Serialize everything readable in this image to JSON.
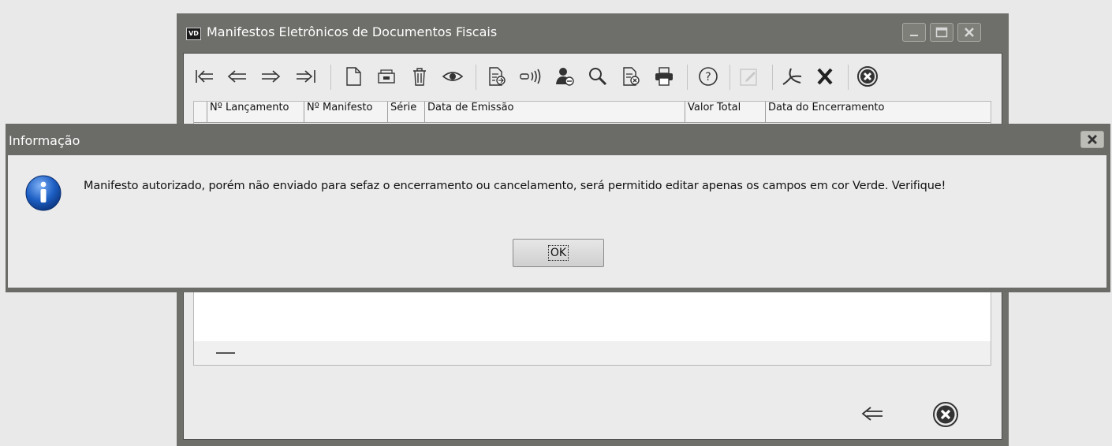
{
  "window": {
    "title": "Manifestos Eletrônicos de Documentos Fiscais",
    "logo_text": "VD"
  },
  "toolbar": {
    "icons": [
      "first-record-icon",
      "previous-record-icon",
      "next-record-icon",
      "last-record-icon",
      "new-document-icon",
      "archive-icon",
      "delete-icon",
      "view-icon",
      "document-import-icon",
      "transmit-icon",
      "user-icon",
      "search-icon",
      "cancel-document-icon",
      "print-icon",
      "help-icon",
      "edit-icon",
      "pdf-icon",
      "close-x-icon",
      "exit-icon"
    ]
  },
  "grid": {
    "columns": [
      "Nº Lançamento",
      "Nº Manifesto",
      "Série",
      "Data de Emissão",
      "Valor Total",
      "Data do Encerramento"
    ]
  },
  "dialog": {
    "title": "Informação",
    "message": "Manifesto autorizado, porém não enviado para sefaz o encerramento ou cancelamento, será permitido editar apenas os campos em cor Verde. Verifique!",
    "ok_label": "OK"
  },
  "colors": {
    "titlebar": "#6e6e6a",
    "client": "#ebebeb",
    "info_blue": "#1d5fc4"
  }
}
